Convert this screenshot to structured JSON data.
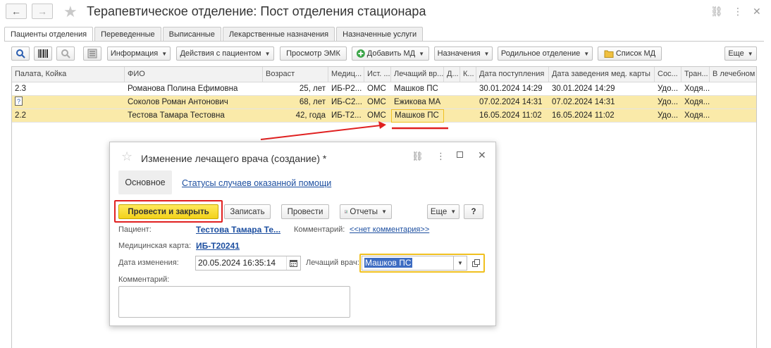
{
  "window": {
    "title": "Терапевтическое отделение: Пост отделения стационара",
    "back_icon": "←",
    "forward_icon": "→",
    "star_icon": "★",
    "link_icon": "⛓",
    "more_icon": "⋮",
    "close_icon": "✕"
  },
  "tabs": [
    "Пациенты отделения",
    "Переведенные",
    "Выписанные",
    "Лекарственные назначения",
    "Назначенные услуги"
  ],
  "toolbar": {
    "information": "Информация",
    "patient_actions": "Действия с пациентом",
    "view_emk": "Просмотр ЭМК",
    "add_md": "Добавить МД",
    "assignments": "Назначения",
    "maternity": "Родильное отделение",
    "md_list": "Список МД",
    "more": "Еще"
  },
  "table": {
    "columns": [
      "Палата, Койка",
      "ФИО",
      "Возраст",
      "Медиц...",
      "Ист. ...",
      "Лечащий вр...",
      "Д...",
      "К...",
      "Дата поступления",
      "Дата заведения мед. карты",
      "Сос...",
      "Тран...",
      "В лечебном"
    ],
    "rows": [
      {
        "bed": "2.3",
        "name": "Романова Полина Ефимовна",
        "age": "25, лет",
        "card": "ИБ-Р2...",
        "source": "ОМС",
        "doctor": "Машков ПС",
        "d": "",
        "k": "",
        "admitted": "30.01.2024 14:29",
        "card_date": "30.01.2024 14:29",
        "state": "Удо...",
        "transport": "Ходя...",
        "extra": ""
      },
      {
        "bed": "",
        "name": "Соколов Роман Антонович",
        "age": "68, лет",
        "card": "ИБ-С2...",
        "source": "ОМС",
        "doctor": "Ежикова МА",
        "d": "",
        "k": "",
        "admitted": "07.02.2024 14:31",
        "card_date": "07.02.2024 14:31",
        "state": "Удо...",
        "transport": "Ходя...",
        "extra": ""
      },
      {
        "bed": "2.2",
        "name": "Тестова Тамара Тестовна",
        "age": "42, года",
        "card": "ИБ-Т2...",
        "source": "ОМС",
        "doctor": "Машков ПС",
        "d": "",
        "k": "",
        "admitted": "16.05.2024 11:02",
        "card_date": "16.05.2024 11:02",
        "state": "Удо...",
        "transport": "Ходя...",
        "extra": ""
      }
    ]
  },
  "dialog": {
    "title": "Изменение лечащего врача (создание) *",
    "tab_main": "Основное",
    "tab_statuses": "Статусы случаев оказанной помощи",
    "btn_post_close": "Провести и закрыть",
    "btn_save": "Записать",
    "btn_post": "Провести",
    "btn_reports": "Отчеты",
    "btn_more": "Еще",
    "btn_help": "?",
    "patient_label": "Пациент:",
    "patient_value": "Тестова Тамара Те...",
    "comment_label": "Комментарий:",
    "comment_link": "<<нет комментария>>",
    "card_label": "Медицинская карта:",
    "card_value": "ИБ-Т20241",
    "date_label": "Дата изменения:",
    "date_value": "20.05.2024 16:35:14",
    "doctor_label": "Лечащий врач:",
    "doctor_value": "Машков ПС",
    "comment_field_label": "Комментарий:",
    "comment_value": ""
  },
  "colors": {
    "highlight_row": "#faeaa9",
    "accent_yellow": "#f5dc3c",
    "annotation_red": "#e02020",
    "link_blue": "#1d4fa0"
  }
}
